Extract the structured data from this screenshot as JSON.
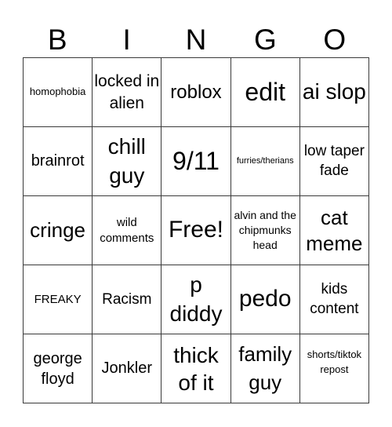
{
  "header": {
    "letters": [
      "B",
      "I",
      "N",
      "G",
      "O"
    ]
  },
  "card": {
    "rows": [
      [
        "homophobia",
        "locked in alien",
        "roblox",
        "edit",
        "ai slop"
      ],
      [
        "brainrot",
        "chill guy",
        "9/11",
        "furries/therians",
        "low taper fade"
      ],
      [
        "cringe",
        "wild comments",
        "Free!",
        "alvin and the chipmunks head",
        "cat meme"
      ],
      [
        "FREAKY",
        "Racism",
        "p diddy",
        "pedo",
        "kids content"
      ],
      [
        "george floyd",
        "Jonkler",
        "thick of it",
        "family guy",
        "shorts/tiktok repost"
      ]
    ],
    "free_space": "Free!"
  },
  "colors": {
    "grid_line": "#3a3a3a",
    "background": "#ffffff",
    "text": "#000000"
  }
}
